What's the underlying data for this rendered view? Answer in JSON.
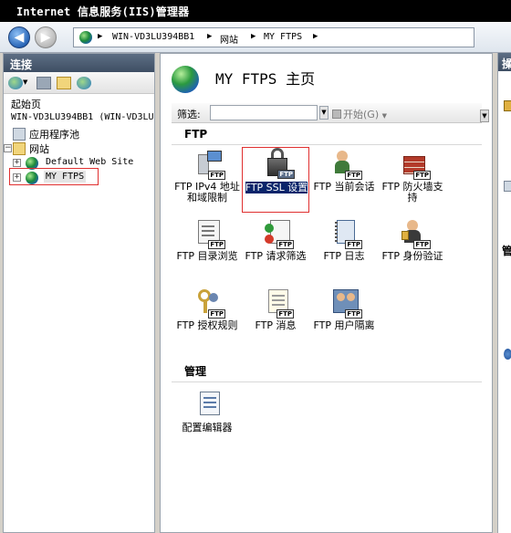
{
  "window": {
    "title": "Internet 信息服务(IIS)管理器"
  },
  "address": {
    "segments": [
      "WIN-VD3LU394BB1",
      "网站",
      "MY FTPS"
    ]
  },
  "connections": {
    "header": "连接",
    "tree": {
      "start_page": "起始页",
      "server": "WIN-VD3LU394BB1 (WIN-VD3LU",
      "app_pools": "应用程序池",
      "sites": "网站",
      "site_default": "Default Web Site",
      "site_ftps": "MY FTPS"
    }
  },
  "main": {
    "title": "MY FTPS 主页",
    "filter": {
      "label": "筛选:",
      "value": "",
      "start_label": "开始(G)"
    },
    "section_ftp": "FTP",
    "ftp_items": [
      {
        "label": "FTP IPv4 地址和域限制",
        "icon": "ipv4-restriction-icon"
      },
      {
        "label": "FTP SSL 设置",
        "icon": "ssl-lock-icon"
      },
      {
        "label": "FTP 当前会话",
        "icon": "sessions-icon"
      },
      {
        "label": "FTP 防火墙支持",
        "icon": "firewall-icon"
      },
      {
        "label": "FTP 目录浏览",
        "icon": "directory-browsing-icon"
      },
      {
        "label": "FTP 请求筛选",
        "icon": "request-filtering-icon"
      },
      {
        "label": "FTP 日志",
        "icon": "logging-icon"
      },
      {
        "label": "FTP 身份验证",
        "icon": "authentication-icon"
      },
      {
        "label": "FTP 授权规则",
        "icon": "authorization-icon"
      },
      {
        "label": "FTP 消息",
        "icon": "messages-icon"
      },
      {
        "label": "FTP 用户隔离",
        "icon": "user-isolation-icon"
      }
    ],
    "selected_item": "FTP SSL 设置",
    "section_manage": "管理",
    "manage_items": [
      {
        "label": "配置编辑器",
        "icon": "config-editor-icon"
      }
    ]
  },
  "actions": {
    "header": "操",
    "labels": [
      "管"
    ]
  },
  "colors": {
    "accent": "#0a246a",
    "panel_header": "#4a5a70",
    "highlight_border": "#e03030"
  }
}
